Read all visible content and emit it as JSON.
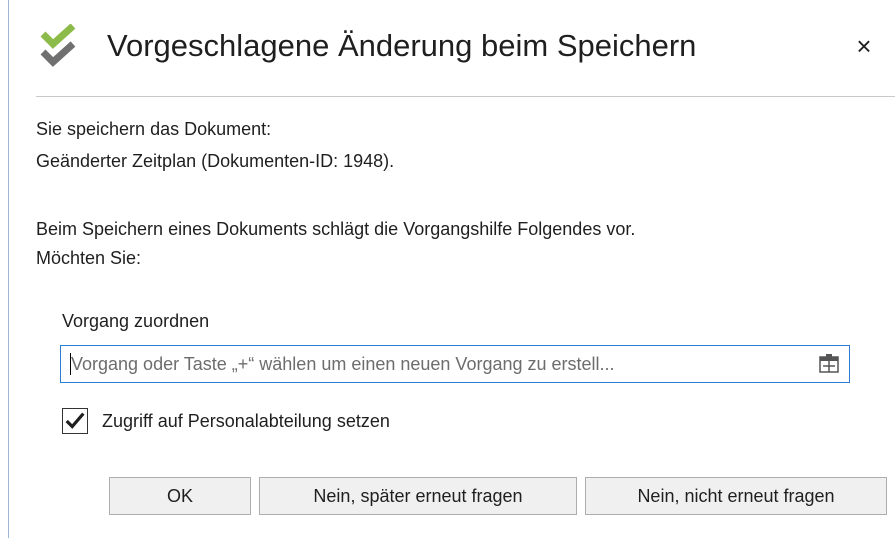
{
  "dialog": {
    "title": "Vorgeschlagene Änderung beim Speichern",
    "close_label": "×",
    "icons": {
      "title_icon": "double-checkmark-icon",
      "close_icon": "close-icon",
      "picker_icon": "picker-icon"
    }
  },
  "message": {
    "line1": "Sie speichern das Dokument:",
    "line2": "Geänderter Zeitplan (Dokumenten-ID: 1948).",
    "line3": "Beim Speichern eines Dokuments schlägt die Vorgangshilfe Folgendes vor.",
    "line4": "Möchten Sie:"
  },
  "assign": {
    "label": "Vorgang zuordnen",
    "value": "",
    "placeholder": "Vorgang oder Taste „+“ wählen um einen neuen Vorgang zu erstell..."
  },
  "access": {
    "checked": true,
    "label": "Zugriff auf Personalabteilung setzen"
  },
  "buttons": {
    "ok": "OK",
    "later": "Nein, später erneut fragen",
    "never": "Nein, nicht erneut fragen"
  },
  "colors": {
    "accent": "#2b7cd3",
    "icon_green": "#8dbb4a",
    "icon_gray": "#707070"
  }
}
